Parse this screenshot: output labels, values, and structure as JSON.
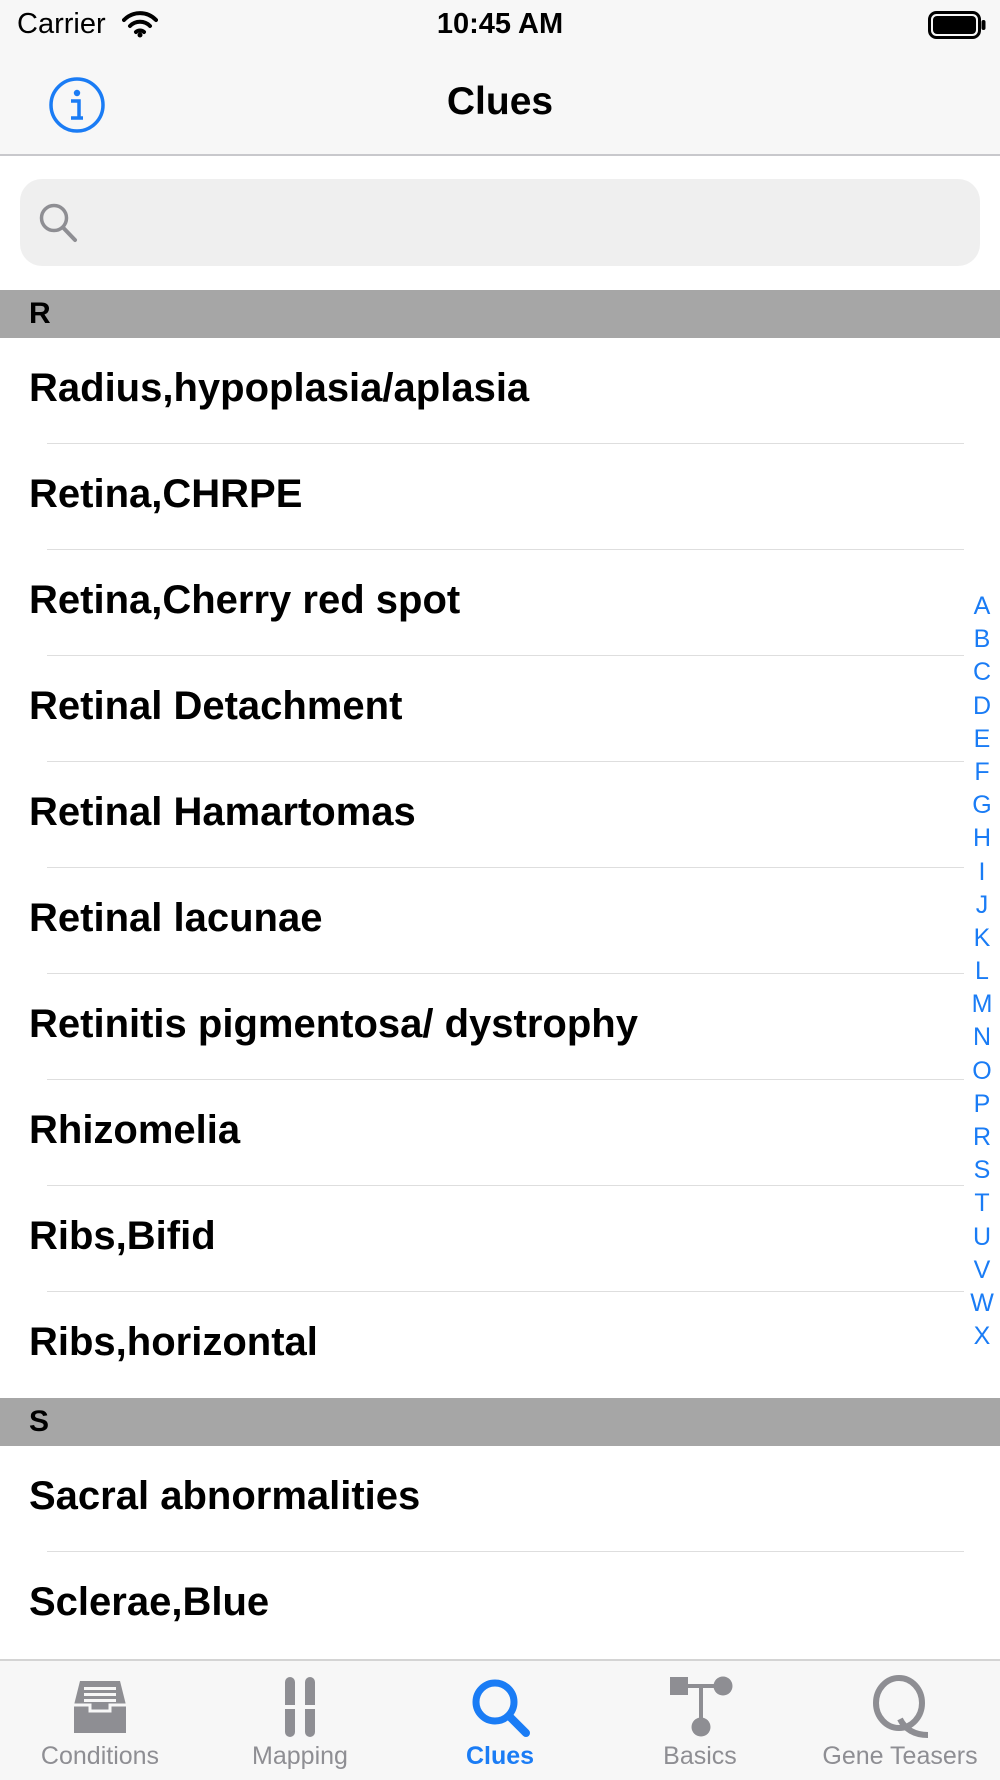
{
  "status_bar": {
    "carrier": "Carrier",
    "time": "10:45 AM"
  },
  "nav": {
    "title": "Clues"
  },
  "search": {
    "placeholder": ""
  },
  "sections": [
    {
      "header": "R",
      "rows": [
        "Radius,hypoplasia/aplasia",
        "Retina,CHRPE",
        "Retina,Cherry red spot",
        "Retinal Detachment",
        "Retinal Hamartomas",
        "Retinal lacunae",
        "Retinitis pigmentosa/ dystrophy",
        "Rhizomelia",
        "Ribs,Bifid",
        "Ribs,horizontal"
      ]
    },
    {
      "header": "S",
      "rows": [
        "Sacral abnormalities",
        "Sclerae,Blue"
      ]
    }
  ],
  "index_letters": [
    "A",
    "B",
    "C",
    "D",
    "E",
    "F",
    "G",
    "H",
    "I",
    "J",
    "K",
    "L",
    "M",
    "N",
    "O",
    "P",
    "R",
    "S",
    "T",
    "U",
    "V",
    "W",
    "X"
  ],
  "tabs": [
    {
      "label": "Conditions",
      "icon": "inbox-tray-icon"
    },
    {
      "label": "Mapping",
      "icon": "chromosome-icon"
    },
    {
      "label": "Clues",
      "icon": "search-icon",
      "active": true
    },
    {
      "label": "Basics",
      "icon": "pedigree-icon"
    },
    {
      "label": "Gene Teasers",
      "icon": "q-letter-icon"
    }
  ],
  "colors": {
    "accent": "#1a7cf5",
    "section_header": "#a6a6a6",
    "inactive_tab": "#8e8e93"
  }
}
